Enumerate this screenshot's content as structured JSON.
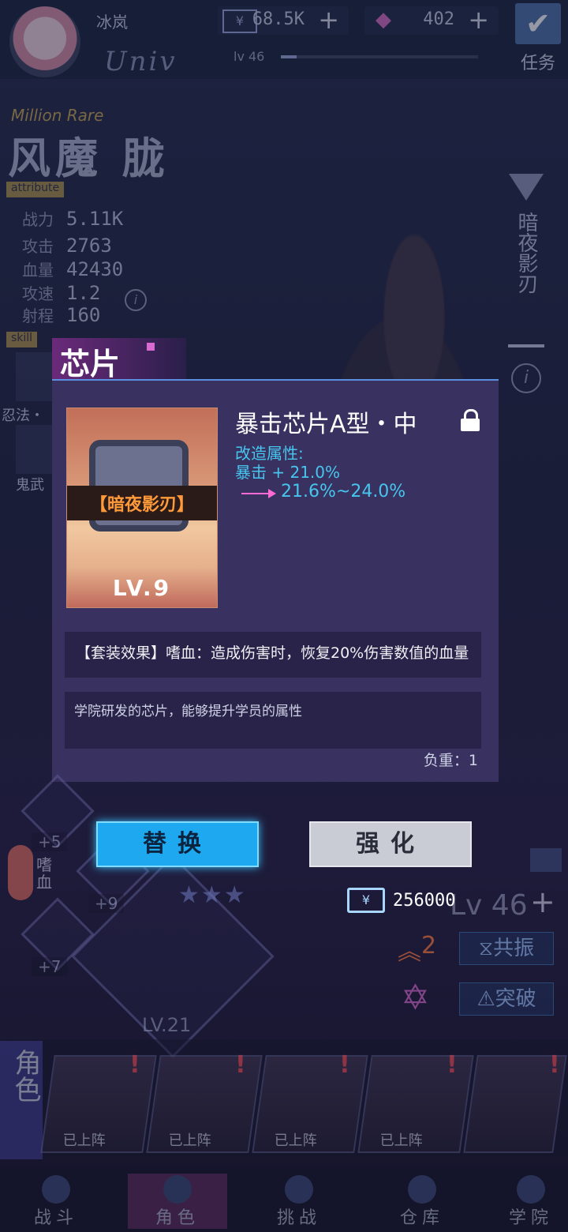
{
  "header": {
    "player_name": "冰岚",
    "guild": "Univ",
    "currency_value": "68.5K",
    "gem_value": "402",
    "level_label": "lv 46",
    "level_progress": 0.08,
    "task_label": "任务"
  },
  "character": {
    "rarity": "Million Rare",
    "name": "风魔 胧",
    "attribute_label": "attribute",
    "skill_label": "skill",
    "stats": [
      {
        "label": "战力",
        "value": "5.11K"
      },
      {
        "label": "攻击",
        "value": "2763"
      },
      {
        "label": "血量",
        "value": "42430"
      },
      {
        "label": "攻速",
        "value": "1.2"
      },
      {
        "label": "射程",
        "value": "160"
      }
    ],
    "skills": [
      "忍法・",
      "鬼武"
    ],
    "side_title": "暗夜影刃"
  },
  "chip": {
    "panel_title": "芯片",
    "name": "暴击芯片A型・中",
    "set_name": "【暗夜影刃】",
    "level": "LV.9",
    "mod_label": "改造属性:",
    "mod_value": "暴击 + 21.0%",
    "mod_range": "21.6%~24.0%",
    "set_effect": "【套装效果】嗜血：造成伤害时，恢复20%伤害数值的血量",
    "description": "学院研发的芯片，能够提升学员的属性",
    "weight": "负重：1"
  },
  "actions": {
    "replace_label": "替换",
    "enhance_label": "强化",
    "cost": "256000"
  },
  "equipment": {
    "weapon_level": "LV.21",
    "slot_levels": [
      "+5",
      "+9",
      "+7"
    ],
    "bloodthirst": "嗜血",
    "char_level": "Lv 46",
    "star_count": "2",
    "resonance_label": "共振",
    "breakthrough_label": "突破"
  },
  "roster": {
    "tab_label": "角色",
    "heroes": [
      {
        "status": "已上阵"
      },
      {
        "status": "已上阵"
      },
      {
        "status": "已上阵"
      },
      {
        "status": "已上阵"
      },
      {
        "status": ""
      }
    ]
  },
  "nav": {
    "items": [
      "战斗",
      "角色",
      "挑战",
      "仓库",
      "学院"
    ]
  },
  "colors": {
    "accent_blue": "#1ea8f0",
    "cyan_text": "#46c6ee",
    "set_orange": "#ff9a3a",
    "panel_purple": "#3a3262"
  }
}
